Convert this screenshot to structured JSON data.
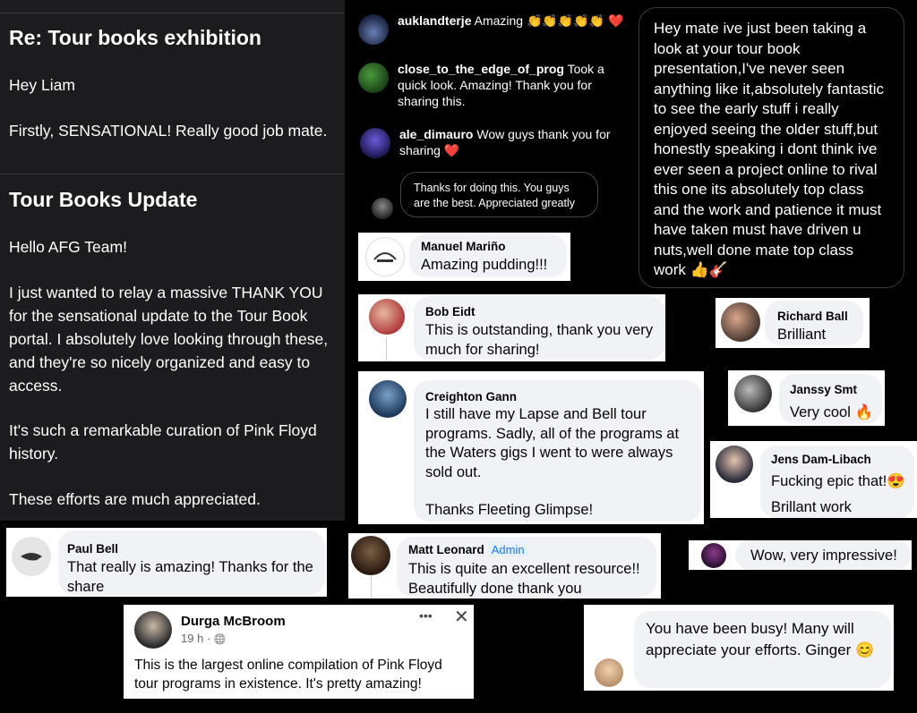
{
  "email": {
    "subject1": "Re: Tour books exhibition",
    "greeting1": "Hey Liam",
    "body1": "Firstly, SENSATIONAL! Really good job mate.",
    "subject2": "Tour Books Update",
    "greeting2": "Hello AFG Team!",
    "body2": "I just wanted to relay a massive THANK YOU for the sensational update to the Tour Book portal.  I absolutely love looking through these, and they're so nicely organized and easy to access.",
    "body3": "It's such a remarkable curation of Pink Floyd history.",
    "body4": "These efforts are much appreciated."
  },
  "instagram": [
    {
      "user": "auklandterje",
      "text": "Amazing 👏👏👏👏👏 ❤️"
    },
    {
      "user": "close_to_the_edge_of_prog",
      "text": "Took a quick look. Amazing! Thank you for sharing this."
    },
    {
      "user": "ale_dimauro",
      "text": "Wow guys thank you for sharing ❤️"
    }
  ],
  "insta_reply": "Thanks for doing this.  You guys are the best.  Appreciated greatly",
  "big_message": "Hey mate ive just been taking a look at your tour book presentation,I've never seen anything like it,absolutely fantastic to see the early stuff i really enjoyed seeing the older stuff,but honestly speaking i dont think ive ever seen a project online to rival this one its absolutely top class and the work and patience it must have taken must have driven u nuts,well done mate top class work 👍🎸",
  "facebook": {
    "manuel": {
      "name": "Manuel Mariño",
      "text": "Amazing pudding!!!"
    },
    "bob": {
      "name": "Bob Eidt",
      "text": "This is outstanding, thank you very much for sharing!"
    },
    "richard": {
      "name": "Richard Ball",
      "text": "Brilliant"
    },
    "creighton": {
      "name": "Creighton Gann",
      "text": "I still have my Lapse and Bell tour programs. Sadly, all of the programs at the Waters gigs I went to were always sold out.",
      "text2": "Thanks Fleeting Glimpse!"
    },
    "janssy": {
      "name": "Janssy Smt",
      "text": "Very cool 🔥"
    },
    "jens": {
      "name": "Jens Dam-Libach",
      "text": "Fucking epic that!😍",
      "text2": "Brillant work"
    },
    "paul": {
      "name": "Paul Bell",
      "text": "That really is amazing! Thanks for the share"
    },
    "matt": {
      "name": "Matt Leonard",
      "badge": "Admin",
      "text": "This is quite an excellent resource!! Beautifully done thank you"
    },
    "wow": {
      "text": "Wow, very impressive!"
    },
    "durga": {
      "name": "Durga McBroom",
      "time": "19 h ·",
      "text": "This is the largest online compilation of Pink Floyd tour programs in existence. It's pretty amazing!"
    },
    "ginger": {
      "text": "You have been busy! Many will appreciate your efforts. Ginger 😊"
    }
  },
  "icons": {
    "more": "•••",
    "close": "✕",
    "globe": "🌐"
  }
}
